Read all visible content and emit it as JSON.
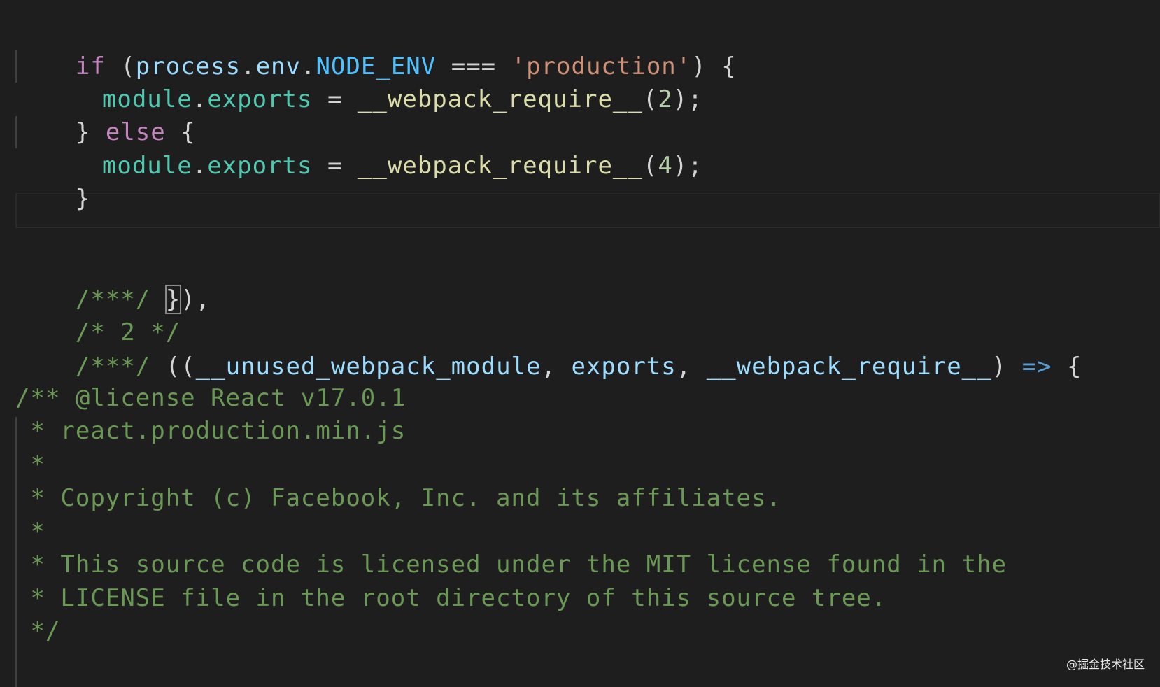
{
  "code": {
    "line1": {
      "t1": "if",
      "t2": " (",
      "t3": "process",
      "t4": ".",
      "t5": "env",
      "t6": ".",
      "t7": "NODE_ENV",
      "t8": " === ",
      "t9": "'production'",
      "t10": ") {"
    },
    "line2": {
      "t1": "module",
      "t2": ".",
      "t3": "exports",
      "t4": " = ",
      "t5": "__webpack_require__",
      "t6": "(",
      "t7": "2",
      "t8": ");"
    },
    "line3": {
      "t1": "} ",
      "t2": "else",
      "t3": " {"
    },
    "line4": {
      "t1": "module",
      "t2": ".",
      "t3": "exports",
      "t4": " = ",
      "t5": "__webpack_require__",
      "t6": "(",
      "t7": "4",
      "t8": ");"
    },
    "line5": {
      "t1": "}"
    },
    "line7": {
      "t1": "/***/ ",
      "t2": "}",
      "t3": "),"
    },
    "line8": {
      "t1": "/* 2 */"
    },
    "line9": {
      "t1": "/***/ ",
      "t2": "((",
      "t3": "__unused_webpack_module",
      "t4": ", ",
      "t5": "exports",
      "t6": ", ",
      "t7": "__webpack_require__",
      "t8": ") ",
      "t9": "=>",
      "t10": " {"
    },
    "comment": [
      "/** @license React v17.0.1",
      " * react.production.min.js",
      " *",
      " * Copyright (c) Facebook, Inc. and its affiliates.",
      " *",
      " * This source code is licensed under the MIT license found in the",
      " * LICENSE file in the root directory of this source tree.",
      " */"
    ]
  },
  "watermark": "@掘金技术社区",
  "colors": {
    "background": "#1e1e1e",
    "keyword": "#c586c0",
    "variable": "#9cdcfe",
    "constant": "#4fc1ff",
    "string": "#ce9178",
    "module": "#4ec9b0",
    "function": "#dcdcaa",
    "number": "#b5cea8",
    "arrow": "#569cd6",
    "comment": "#6a9955",
    "text": "#d4d4d4"
  }
}
